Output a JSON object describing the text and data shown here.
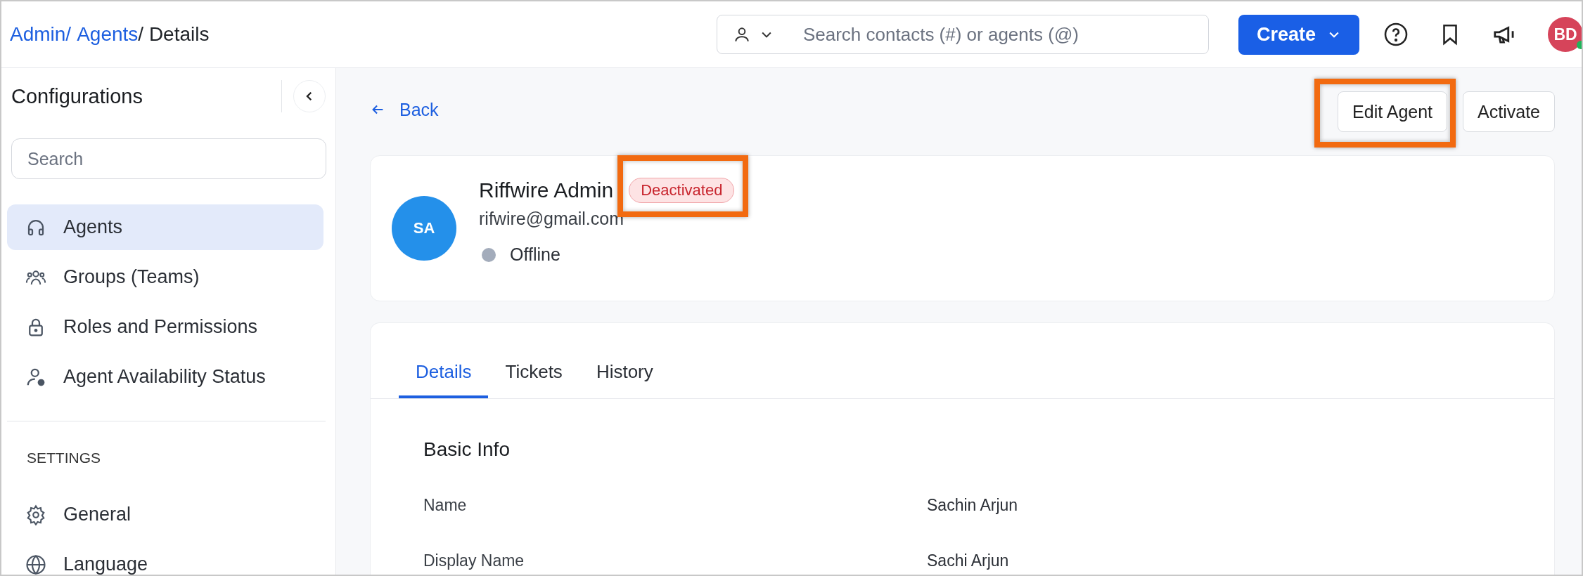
{
  "breadcrumb": [
    {
      "label": "Admin/",
      "link": true
    },
    {
      "label": "Agents",
      "link": true
    },
    {
      "label": "/ Details",
      "link": false
    }
  ],
  "search": {
    "placeholder": "Search contacts (#) or agents (@)"
  },
  "create_button": "Create",
  "user_avatar": {
    "initials": "BD",
    "online": true
  },
  "sidebar": {
    "title": "Configurations",
    "search_placeholder": "Search",
    "items": [
      {
        "label": "Agents",
        "selected": true
      },
      {
        "label": "Groups (Teams)",
        "selected": false
      },
      {
        "label": "Roles and Permissions",
        "selected": false
      },
      {
        "label": "Agent Availability Status",
        "selected": false
      }
    ],
    "section": "SETTINGS",
    "settings_items": [
      {
        "label": "General",
        "selected": false
      },
      {
        "label": "Language",
        "selected": false
      }
    ]
  },
  "back": "Back",
  "actions": [
    {
      "label": "Edit Agent",
      "highlighted": true
    },
    {
      "label": "Activate",
      "highlighted": false
    }
  ],
  "agent": {
    "initials": "SA",
    "name": "Riffwire Admin",
    "status_badge": "Deactivated",
    "badge_highlighted": true,
    "email": "rifwire@gmail.com",
    "presence": "Offline",
    "online": false
  },
  "tabs": [
    {
      "label": "Details",
      "selected": true
    },
    {
      "label": "Tickets",
      "selected": false
    },
    {
      "label": "History",
      "selected": false
    }
  ],
  "section_title": "Basic Info",
  "fields": [
    {
      "label": "Name",
      "value": "Sachin Arjun"
    },
    {
      "label": "Display Name",
      "value": "Sachi Arjun"
    }
  ]
}
